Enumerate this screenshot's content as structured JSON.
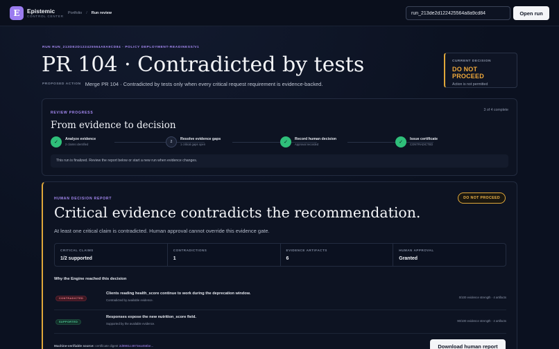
{
  "brand": {
    "logo_letter": "E",
    "name": "Epistemic",
    "sub": "CONTROL CENTER"
  },
  "breadcrumb": {
    "parent": "Portfolio",
    "separator": "/",
    "current": "Run review"
  },
  "search": {
    "value": "run_213de2d122425564a8a9cd84"
  },
  "open_button": "Open run",
  "run_label": "RUN RUN_213DE2D122425564A8A9CD84 · POLICY DEPLOYMENT-READINESS/V1",
  "title": "PR 104 · Contradicted by tests",
  "proposed_action": {
    "label": "PROPOSED ACTION",
    "text": "Merge PR 104 · Contradicted by tests only when every critical request requirement is evidence-backed."
  },
  "current_decision": {
    "label": "CURRENT DECISION",
    "value": "DO NOT PROCEED",
    "sub": "Action is not permitted",
    "accent": "#f0a93a"
  },
  "review_progress": {
    "eyebrow": "REVIEW PROGRESS",
    "count": "3 of 4 complete",
    "title": "From evidence to decision",
    "steps": [
      {
        "marker": "✓",
        "status": "done",
        "title": "Analyze evidence",
        "sub": "2 claims identified"
      },
      {
        "marker": "2",
        "status": "pending",
        "title": "Resolve evidence gaps",
        "sub": "1 critical gaps open"
      },
      {
        "marker": "✓",
        "status": "done",
        "title": "Record human decision",
        "sub": "Approval recorded"
      },
      {
        "marker": "✓",
        "status": "done",
        "title": "Issue certificate",
        "sub": "CONTRADICTED"
      }
    ],
    "note": "This run is finalized. Review the report below or start a new run when evidence changes."
  },
  "report": {
    "eyebrow": "HUMAN DECISION REPORT",
    "badge": "DO NOT PROCEED",
    "headline": "Critical evidence contradicts the recommendation.",
    "summary": "At least one critical claim is contradicted. Human approval cannot override this evidence gate.",
    "metrics": [
      {
        "label": "CRITICAL CLAIMS",
        "value": "1/2 supported"
      },
      {
        "label": "CONTRADICTIONS",
        "value": "1"
      },
      {
        "label": "EVIDENCE ARTIFACTS",
        "value": "6"
      },
      {
        "label": "HUMAN APPROVAL",
        "value": "Granted"
      }
    ],
    "why_title": "Why the Engine reached this decision",
    "claims": [
      {
        "tag": "CONTRADICTED",
        "title": "Clients reading health_score continue to work during the deprecation window.",
        "sub": "Contradicted by available evidence.",
        "strength": "0/100 evidence strength · 4 artifacts"
      },
      {
        "tag": "SUPPORTED",
        "title": "Responses expose the new nutrition_score field.",
        "sub": "Supported by the available evidence.",
        "strength": "90/100 evidence strength · 4 artifacts"
      }
    ],
    "machine_label": "Machine-verifiable source:",
    "machine_text": "certificate digest",
    "digest": "2d8981c4973ea456be...",
    "download_button": "Download human report"
  }
}
